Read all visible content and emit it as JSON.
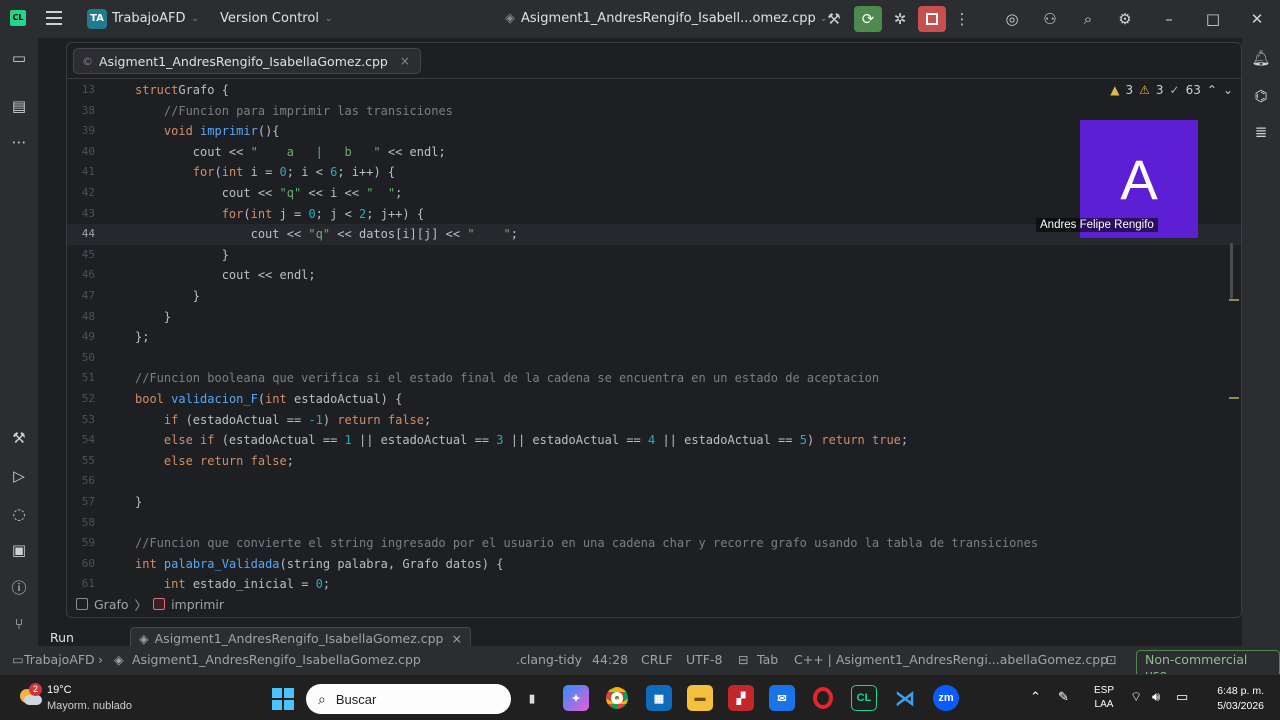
{
  "titlebar": {
    "logo": "CL",
    "project_badge": "TA",
    "project_name": "TrabajoAFD",
    "vcs": "Version Control",
    "run_config": "Asigment1_AndresRengifo_Isabell...omez.cpp",
    "window_controls": {
      "minimize": "–",
      "maximize": "□",
      "close": "✕"
    }
  },
  "editor": {
    "tab_label": "Asigment1_AndresRengifo_IsabellaGomez.cpp",
    "tab_close": "×",
    "inspections": {
      "errors": "3",
      "warnings": "3",
      "weak": "63"
    },
    "lines": [
      {
        "n": "13",
        "segs": [
          [
            "ty",
            "struct"
          ],
          [
            "",
            "Grafo {"
          ]
        ]
      },
      {
        "n": "38",
        "segs": [
          [
            "",
            "    "
          ],
          [
            "cm",
            "//Funcion para imprimir las transiciones"
          ]
        ]
      },
      {
        "n": "39",
        "segs": [
          [
            "",
            "    "
          ],
          [
            "ty",
            "void"
          ],
          [
            "",
            " "
          ],
          [
            "fn",
            "imprimir"
          ],
          [
            "",
            "(){"
          ]
        ]
      },
      {
        "n": "40",
        "segs": [
          [
            "",
            "        cout << "
          ],
          [
            "st",
            "\"    a   |   b   \""
          ],
          [
            "",
            " << endl;"
          ]
        ]
      },
      {
        "n": "41",
        "segs": [
          [
            "",
            "        "
          ],
          [
            "kw",
            "for"
          ],
          [
            "",
            "("
          ],
          [
            "ty",
            "int"
          ],
          [
            "",
            " i = "
          ],
          [
            "nm",
            "0"
          ],
          [
            "",
            "; i < "
          ],
          [
            "nm",
            "6"
          ],
          [
            "",
            "; i++) {"
          ]
        ]
      },
      {
        "n": "42",
        "segs": [
          [
            "",
            "            cout << "
          ],
          [
            "st",
            "\"q\""
          ],
          [
            "",
            " << i << "
          ],
          [
            "st",
            "\"  \""
          ],
          [
            "",
            ";"
          ]
        ]
      },
      {
        "n": "43",
        "segs": [
          [
            "",
            "            "
          ],
          [
            "kw",
            "for"
          ],
          [
            "",
            "("
          ],
          [
            "ty",
            "int"
          ],
          [
            "",
            " j = "
          ],
          [
            "nm",
            "0"
          ],
          [
            "",
            "; j < "
          ],
          [
            "nm",
            "2"
          ],
          [
            "",
            "; j++) {"
          ]
        ]
      },
      {
        "n": "44",
        "segs": [
          [
            "",
            "                cout << "
          ],
          [
            "st",
            "\"q\""
          ],
          [
            "",
            " << datos[i][j] << "
          ],
          [
            "st",
            "\"    \""
          ],
          [
            "",
            ";"
          ]
        ]
      },
      {
        "n": "45",
        "segs": [
          [
            "",
            "            }"
          ]
        ]
      },
      {
        "n": "46",
        "segs": [
          [
            "",
            "            cout << endl;"
          ]
        ]
      },
      {
        "n": "47",
        "segs": [
          [
            "",
            "        }"
          ]
        ]
      },
      {
        "n": "48",
        "segs": [
          [
            "",
            "    }"
          ]
        ]
      },
      {
        "n": "49",
        "segs": [
          [
            "",
            "};"
          ]
        ]
      },
      {
        "n": "50",
        "segs": [
          [
            "",
            ""
          ]
        ]
      },
      {
        "n": "51",
        "segs": [
          [
            "cm",
            "//Funcion booleana que verifica si el estado final de la cadena se encuentra en un estado de aceptacion"
          ]
        ]
      },
      {
        "n": "52",
        "segs": [
          [
            "ty",
            "bool"
          ],
          [
            "",
            " "
          ],
          [
            "fn",
            "validacion_F"
          ],
          [
            "",
            "("
          ],
          [
            "ty",
            "int"
          ],
          [
            "",
            " estadoActual) {"
          ]
        ]
      },
      {
        "n": "53",
        "segs": [
          [
            "",
            "    "
          ],
          [
            "kw",
            "if"
          ],
          [
            "",
            " (estadoActual == "
          ],
          [
            "nm",
            "-1"
          ],
          [
            "",
            ") "
          ],
          [
            "kw",
            "return false"
          ],
          [
            "",
            ";"
          ]
        ]
      },
      {
        "n": "54",
        "segs": [
          [
            "",
            "    "
          ],
          [
            "kw",
            "else if"
          ],
          [
            "",
            " (estadoActual == "
          ],
          [
            "nm",
            "1"
          ],
          [
            "",
            " || estadoActual == "
          ],
          [
            "nm",
            "3"
          ],
          [
            "",
            " || estadoActual == "
          ],
          [
            "nm",
            "4"
          ],
          [
            "",
            " || estadoActual == "
          ],
          [
            "nm",
            "5"
          ],
          [
            "",
            ") "
          ],
          [
            "kw",
            "return true"
          ],
          [
            "",
            ";"
          ]
        ]
      },
      {
        "n": "55",
        "segs": [
          [
            "",
            "    "
          ],
          [
            "kw",
            "else return false"
          ],
          [
            "",
            ";"
          ]
        ]
      },
      {
        "n": "56",
        "segs": [
          [
            "",
            ""
          ]
        ]
      },
      {
        "n": "57",
        "segs": [
          [
            "",
            "}"
          ]
        ]
      },
      {
        "n": "58",
        "segs": [
          [
            "",
            ""
          ]
        ]
      },
      {
        "n": "59",
        "segs": [
          [
            "cm",
            "//Funcion que convierte el string ingresado por el usuario en una cadena char y recorre grafo usando la tabla de transiciones"
          ]
        ]
      },
      {
        "n": "60",
        "segs": [
          [
            "ty",
            "int"
          ],
          [
            "",
            " "
          ],
          [
            "fn",
            "palabra_Validada"
          ],
          [
            "",
            "(string palabra, Grafo datos) {"
          ]
        ]
      },
      {
        "n": "61",
        "segs": [
          [
            "",
            "    "
          ],
          [
            "ty",
            "int"
          ],
          [
            "",
            " estado_inicial = "
          ],
          [
            "nm",
            "0"
          ],
          [
            "",
            ";"
          ]
        ]
      }
    ],
    "current_line": "44"
  },
  "video_tile": {
    "initial": "A",
    "name": "Andres Felipe Rengifo",
    "color": "#5d1fd3"
  },
  "breadcrumbs": {
    "struct": "Grafo",
    "sep": "〉",
    "func": "imprimir"
  },
  "run_panel": {
    "label": "Run",
    "tab": "Asigment1_AndresRengifo_IsabellaGomez.cpp"
  },
  "statusbar": {
    "project": "TrabajoAFD",
    "file": "Asigment1_AndresRengifo_IsabellaGomez.cpp",
    "tidy": ".clang-tidy",
    "position": "44:28",
    "line_sep": "CRLF",
    "encoding": "UTF-8",
    "indent": "Tab",
    "lang_file": "C++ | Asigment1_AndresRengi...abellaGomez.cpp",
    "license": "Non-commercial use"
  },
  "taskbar": {
    "weather_badge": "2",
    "temperature": "19°C",
    "condition": "Mayorm. nublado",
    "search_placeholder": "Buscar",
    "language": "ESP",
    "region": "LAA",
    "time": "6:48 p. m.",
    "date": "5/03/2026"
  }
}
